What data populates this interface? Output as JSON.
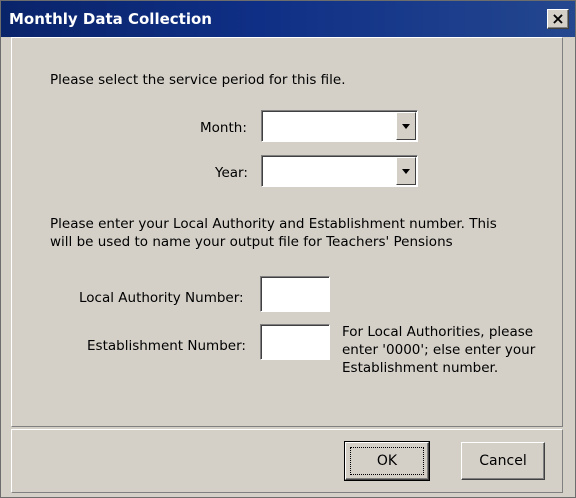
{
  "window": {
    "title": "Monthly Data Collection",
    "close_label": "×"
  },
  "form": {
    "intro": "Please select the service period for this file.",
    "month_label": "Month:",
    "month_value": "",
    "year_label": "Year:",
    "year_value": "",
    "instructions_line1": "Please enter your Local Authority and Establishment number.  This",
    "instructions_line2": "will be used to name your output file for Teachers' Pensions",
    "la_label": "Local Authority Number:",
    "la_value": "",
    "est_label": "Establishment Number:",
    "est_value": "",
    "note_line1": "For Local Authorities, please",
    "note_line2": "enter '0000'; else enter your",
    "note_line3": "Establishment number."
  },
  "buttons": {
    "ok": "OK",
    "cancel": "Cancel"
  }
}
